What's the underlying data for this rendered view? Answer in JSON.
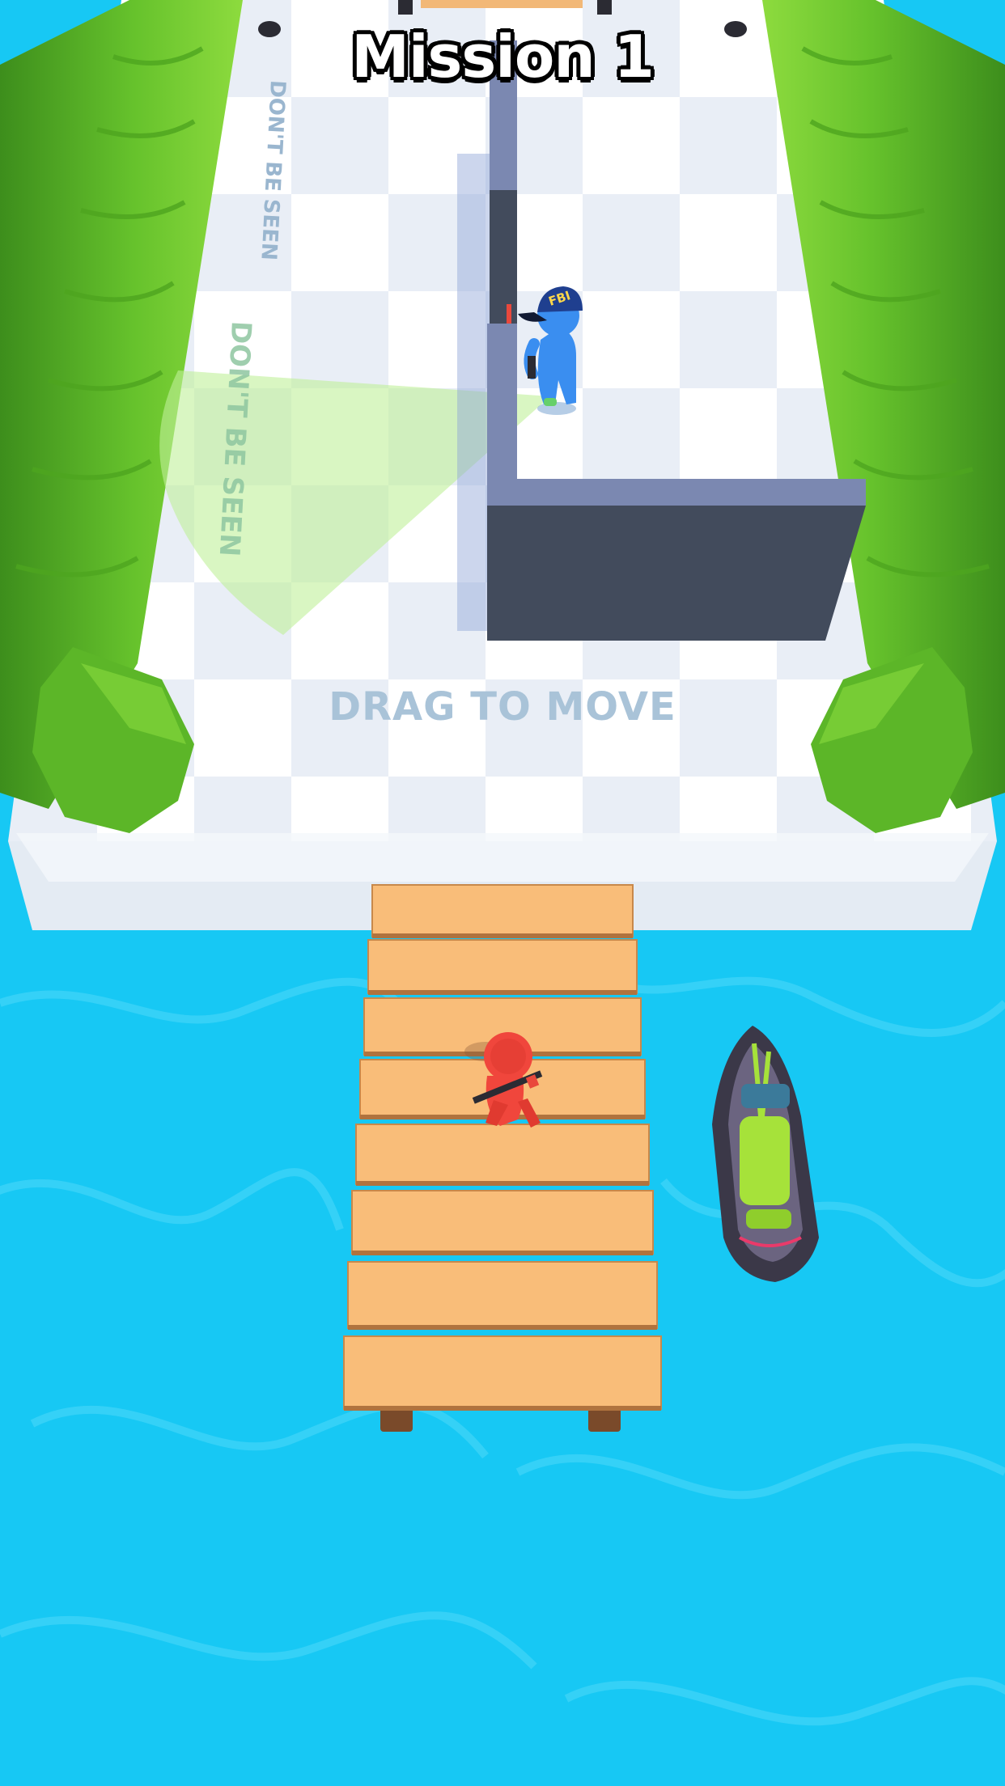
{
  "hud": {
    "mission_title": "Mission 1",
    "drag_hint": "DRAG TO MOVE"
  },
  "floor_labels": {
    "warning_top": "DON'T BE SEEN",
    "warning_cone": "DON'T BE SEEN"
  },
  "characters": {
    "guard_cap_text": "FBI"
  },
  "colors": {
    "water": "#17c8f4",
    "floor_light": "#ffffff",
    "floor_dark": "#e9eef6",
    "hedge": "#66c22c",
    "wall_top": "#7b88b1",
    "wall_side": "#424b5c",
    "dock": "#f9bd79",
    "player": "#f0463c",
    "guard": "#3a8ef0",
    "vision_cone": "#bff09a",
    "jetski_body": "#3b3848",
    "jetski_seat": "#a6e23a"
  }
}
